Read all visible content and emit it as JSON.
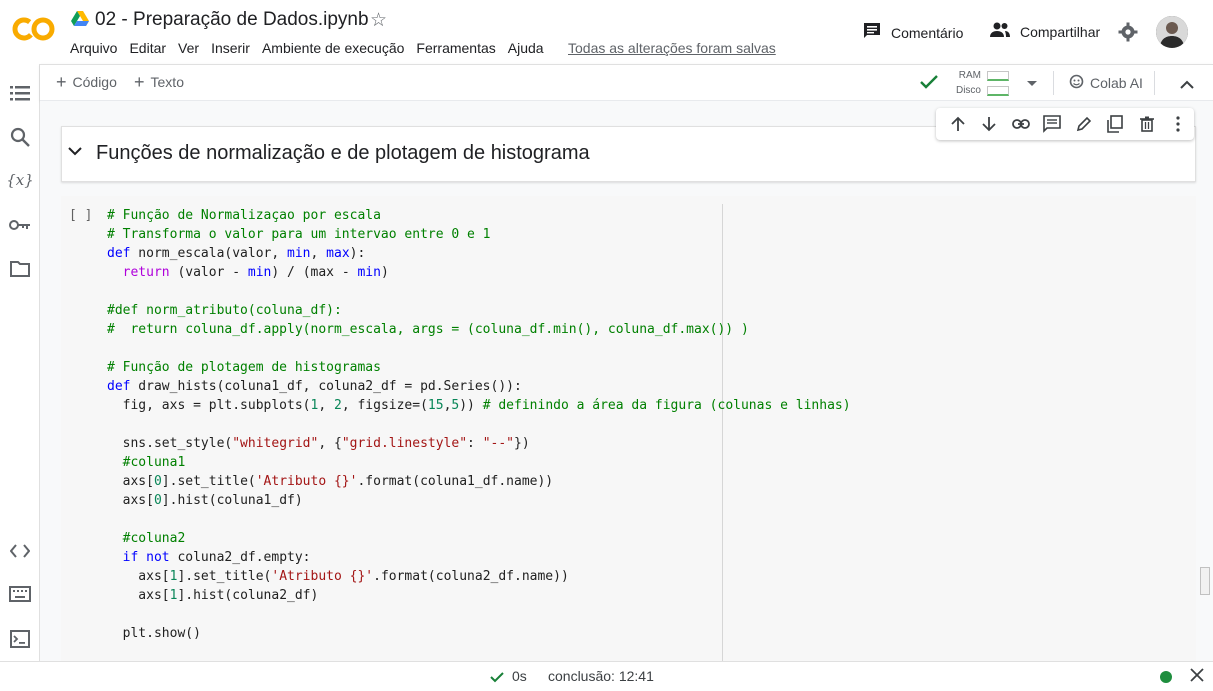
{
  "header": {
    "title": "02 - Preparação de Dados.ipynb",
    "logo_text": "CO",
    "menu": [
      "Arquivo",
      "Editar",
      "Ver",
      "Inserir",
      "Ambiente de execução",
      "Ferramentas",
      "Ajuda"
    ],
    "saved_status": "Todas as alterações foram salvas",
    "comment_label": "Comentário",
    "share_label": "Compartilhar"
  },
  "toolbar": {
    "add_code": "Código",
    "add_text": "Texto",
    "ram_label": "RAM",
    "disk_label": "Disco",
    "colab_ai": "Colab AI"
  },
  "text_cell": {
    "title": "Funções de normalização e de plotagem de histograma"
  },
  "code_cell": {
    "run_indicator": "[ ]",
    "lines": [
      "# Função de Normalizaçao por escala",
      "# Transforma o valor para um intervao entre 0 e 1",
      "def norm_escala(valor, min, max):",
      "  return (valor - min) / (max - min)",
      "",
      "#def norm_atributo(coluna_df):",
      "#  return coluna_df.apply(norm_escala, args = (coluna_df.min(), coluna_df.max()) )",
      "",
      "# Função de plotagem de histogramas",
      "def draw_hists(coluna1_df, coluna2_df = pd.Series()):",
      "  fig, axs = plt.subplots(1, 2, figsize=(15,5)) # definindo a área da figura (colunas e linhas)",
      "",
      "  sns.set_style(\"whitegrid\", {\"grid.linestyle\": \"--\"})",
      "  #coluna1",
      "  axs[0].set_title('Atributo {}'.format(coluna1_df.name))",
      "  axs[0].hist(coluna1_df)",
      "",
      "  #coluna2",
      "  if not coluna2_df.empty:",
      "    axs[1].set_title('Atributo {}'.format(coluna2_df.name))",
      "    axs[1].hist(coluna2_df)",
      "",
      "  plt.show()"
    ]
  },
  "status": {
    "exec_time": "0s",
    "completion": "conclusão: 12:41"
  },
  "colors": {
    "accent_orange": "#f9ab00",
    "status_green": "#1e8e3e",
    "check_green": "#188038"
  }
}
